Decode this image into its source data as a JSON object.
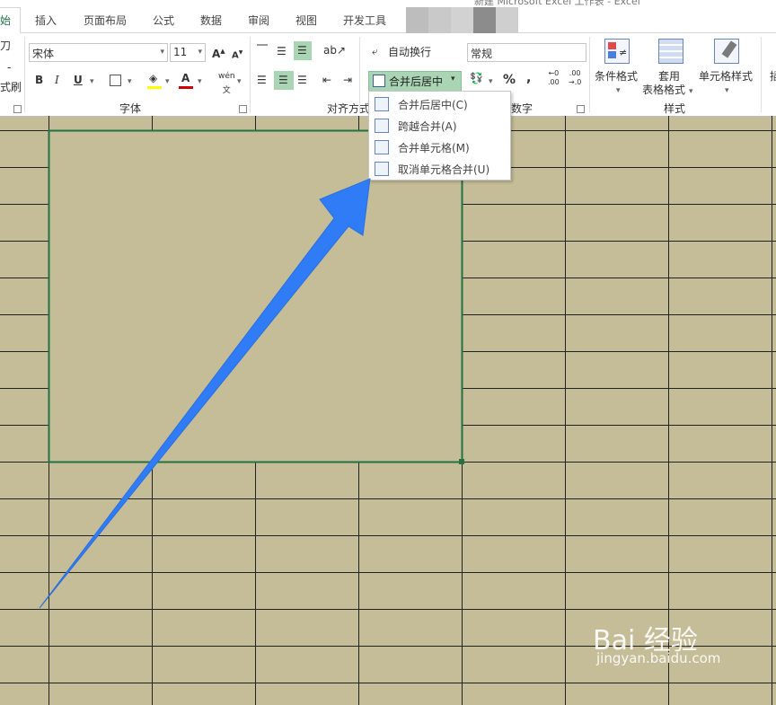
{
  "title_fragment": "新建 Microsoft Excel 工作表 - Excel",
  "tabs": [
    {
      "label": "始",
      "active": true
    },
    {
      "label": "插入"
    },
    {
      "label": "页面布局"
    },
    {
      "label": "公式"
    },
    {
      "label": "数据"
    },
    {
      "label": "审阅"
    },
    {
      "label": "视图"
    },
    {
      "label": "开发工具"
    }
  ],
  "clipboard": {
    "cut_partial": "刀",
    "copy_partial": "-",
    "format_partial": "式刷"
  },
  "font": {
    "name": "宋体",
    "size": "11",
    "group_label": "字体"
  },
  "alignment": {
    "wrap_label": "自动换行",
    "merge_label": "合并后居中",
    "group_label": "对齐方式"
  },
  "number": {
    "format": "常规",
    "group_label": "数字",
    "percent": "%",
    "comma": ","
  },
  "styles": {
    "conditional": "条件格式",
    "table_line1": "套用",
    "table_line2": "表格格式",
    "cell": "单元格样式",
    "group_label": "样式"
  },
  "insert_partial": "插",
  "merge_menu": [
    {
      "label": "合并后居中(C)"
    },
    {
      "label": "跨越合并(A)"
    },
    {
      "label": "合并单元格(M)"
    },
    {
      "label": "取消单元格合并(U)"
    }
  ],
  "colors": {
    "accent": "#217346",
    "sheet": "#c5bd97",
    "arrow": "#2f7cf6",
    "merged_border": "#217346"
  },
  "watermark": {
    "main": "Bai 经验",
    "sub": "jingyan.baidu.com"
  }
}
